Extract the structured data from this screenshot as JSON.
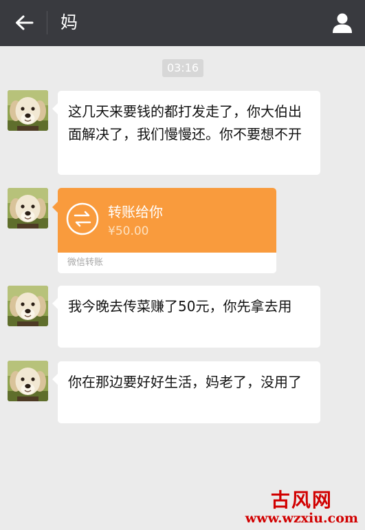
{
  "header": {
    "title": "妈",
    "back_icon": "arrow-left-icon",
    "profile_icon": "user-profile-icon",
    "background_color": "#393a3f"
  },
  "timestamp": "03:16",
  "messages": [
    {
      "type": "text",
      "text": "这几天来要钱的都打发走了，你大伯出面解决了，我们慢慢还。你不要想不开"
    },
    {
      "type": "transfer",
      "title": "转账给你",
      "amount": "¥50.00",
      "footer": "微信转账",
      "accent_color": "#f99b3d"
    },
    {
      "type": "text",
      "text": "我今晚去传菜赚了50元，你先拿去用"
    },
    {
      "type": "text",
      "text": "你在那边要好好生活，妈老了，没用了"
    }
  ],
  "watermark": {
    "site_name": "古风网",
    "url": "www.wzxiu.com",
    "color": "#d10000"
  }
}
